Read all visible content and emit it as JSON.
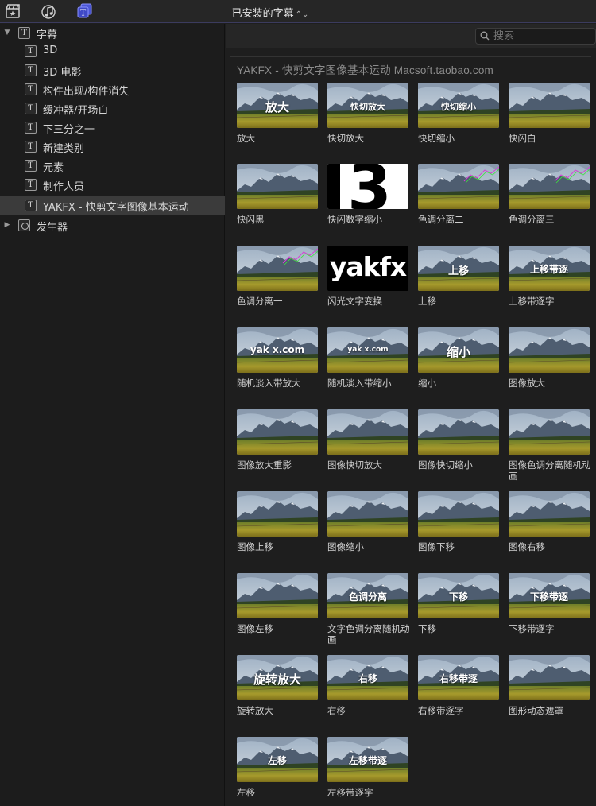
{
  "toolbar": {
    "icons": [
      "clapper-star-icon",
      "music-note-icon",
      "titles-icon"
    ],
    "browser_title": "已安装的字幕",
    "browser_title_chevron": "⌃⌄"
  },
  "sidebar": {
    "root": {
      "label": "字幕",
      "expanded": true
    },
    "items": [
      {
        "label": "3D"
      },
      {
        "label": "3D 电影"
      },
      {
        "label": "构件出现/构件消失"
      },
      {
        "label": "缓冲器/开场白"
      },
      {
        "label": "下三分之一"
      },
      {
        "label": "新建类别"
      },
      {
        "label": "元素"
      },
      {
        "label": "制作人员"
      },
      {
        "label": "YAKFX - 快剪文字图像基本运动",
        "selected": true
      }
    ],
    "generators": {
      "label": "发生器",
      "expanded": false
    }
  },
  "search": {
    "placeholder": "搜索"
  },
  "section": {
    "title": "YAKFX - 快剪文字图像基本运动 Macsoft.taobao.com"
  },
  "tiles": [
    {
      "label": "放大",
      "overlay": "放大",
      "size": 15,
      "kind": "land"
    },
    {
      "label": "快切放大",
      "overlay": "快切放大",
      "size": 11,
      "kind": "land"
    },
    {
      "label": "快切缩小",
      "overlay": "快切缩小",
      "size": 11,
      "kind": "land"
    },
    {
      "label": "快闪白",
      "overlay": "",
      "kind": "land"
    },
    {
      "label": "快闪黑",
      "overlay": "",
      "kind": "land"
    },
    {
      "label": "快闪数字缩小",
      "overlay": "3",
      "kind": "three"
    },
    {
      "label": "色调分离二",
      "overlay": "",
      "kind": "land-glitch"
    },
    {
      "label": "色调分离三",
      "overlay": "",
      "kind": "land-glitch"
    },
    {
      "label": "色调分离一",
      "overlay": "",
      "kind": "land-glitch"
    },
    {
      "label": "闪光文字变换",
      "overlay": "yakfx",
      "kind": "yak"
    },
    {
      "label": "上移",
      "overlay": "上移",
      "size": 13,
      "kind": "land"
    },
    {
      "label": "上移带逐字",
      "overlay": "上移带逐",
      "size": 12,
      "kind": "land"
    },
    {
      "label": "随机淡入带放大",
      "overlay": "yak x.com",
      "size": 12,
      "kind": "land"
    },
    {
      "label": "随机淡入带缩小",
      "overlay": "yak x.com",
      "size": 9,
      "kind": "land"
    },
    {
      "label": "缩小",
      "overlay": "缩小",
      "size": 15,
      "kind": "land"
    },
    {
      "label": "图像放大",
      "overlay": "",
      "kind": "land"
    },
    {
      "label": "图像放大重影",
      "overlay": "",
      "kind": "land"
    },
    {
      "label": "图像快切放大",
      "overlay": "",
      "kind": "land"
    },
    {
      "label": "图像快切缩小",
      "overlay": "",
      "kind": "land"
    },
    {
      "label": "图像色调分离随机动画",
      "overlay": "",
      "kind": "land"
    },
    {
      "label": "图像上移",
      "overlay": "",
      "kind": "land"
    },
    {
      "label": "图像缩小",
      "overlay": "",
      "kind": "land"
    },
    {
      "label": "图像下移",
      "overlay": "",
      "kind": "land"
    },
    {
      "label": "图像右移",
      "overlay": "",
      "kind": "land"
    },
    {
      "label": "图像左移",
      "overlay": "",
      "kind": "land"
    },
    {
      "label": "文字色调分离随机动画",
      "overlay": "色调分离",
      "size": 12,
      "kind": "land"
    },
    {
      "label": "下移",
      "overlay": "下移",
      "size": 12,
      "kind": "land"
    },
    {
      "label": "下移带逐字",
      "overlay": "下移带逐",
      "size": 12,
      "kind": "land"
    },
    {
      "label": "旋转放大",
      "overlay": "旋转放大",
      "size": 15,
      "kind": "land"
    },
    {
      "label": "右移",
      "overlay": "右移",
      "size": 12,
      "kind": "land"
    },
    {
      "label": "右移带逐字",
      "overlay": "右移带逐",
      "size": 12,
      "kind": "land"
    },
    {
      "label": "图形动态遮罩",
      "overlay": "",
      "kind": "land"
    },
    {
      "label": "左移",
      "overlay": "左移",
      "size": 12,
      "kind": "land"
    },
    {
      "label": "左移带逐字",
      "overlay": "左移带逐",
      "size": 12,
      "kind": "land"
    }
  ]
}
